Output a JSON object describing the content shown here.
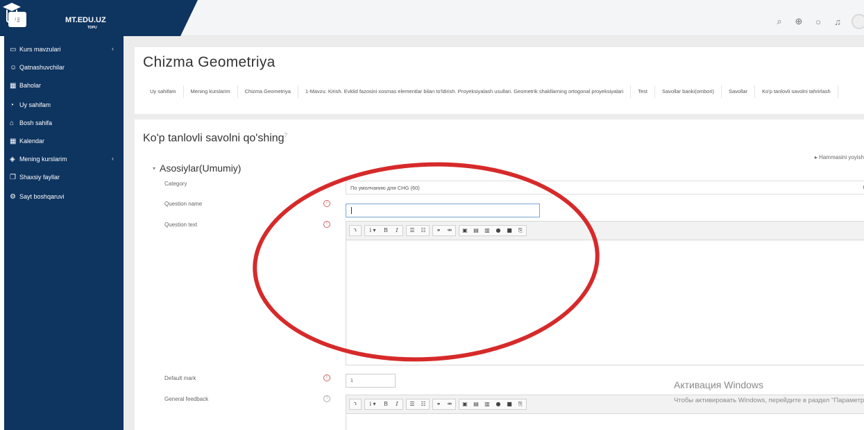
{
  "brand": {
    "name": "MT.EDU.UZ",
    "sub": "TDPU"
  },
  "sidebar": {
    "items": [
      {
        "label": "Kurs mavzulari",
        "icon": "folder-icon",
        "glyph": "▭",
        "chevron": "‹"
      },
      {
        "label": "Qatnashuvchilar",
        "icon": "users-icon",
        "glyph": "☺"
      },
      {
        "label": "Baholar",
        "icon": "grades-icon",
        "glyph": "▦"
      },
      {
        "label": "Uy sahifam",
        "icon": "dashboard-icon",
        "glyph": "◔"
      },
      {
        "label": "Bosh sahifa",
        "icon": "home-icon",
        "glyph": "⌂"
      },
      {
        "label": "Kalendar",
        "icon": "calendar-icon",
        "glyph": "▦"
      },
      {
        "label": "Mening kurslarim",
        "icon": "graduation-cap-icon",
        "glyph": "◈",
        "chevron": "‹"
      },
      {
        "label": "Shaxsiy fayllar",
        "icon": "files-icon",
        "glyph": "❐"
      },
      {
        "label": "Sayt boshqaruvi",
        "icon": "gear-icon",
        "glyph": "⚙"
      }
    ]
  },
  "header": {
    "title": "Chizma Geometriya",
    "breadcrumbs": [
      "Uy sahifam",
      "Mening kurslarim",
      "Chizma Geometriya",
      "1-Mavzu: Kirish. Evklid fazosini xosmas elementlar bilan to'ldirish. Proyeksiyalash usullari. Geometrik shakllarning ortogonal proyeksiyalari",
      "Test",
      "Savollar banki(ombori)",
      "Savollar",
      "Ko'p tanlovli savolni tahrirlash"
    ]
  },
  "form": {
    "heading": "Ko'p tanlovli savolni qo'shing",
    "heading_help": "?",
    "expand_all": "▸ Hammasini yoyish",
    "legend": "Asosiylar(Umumiy)",
    "legend_toggle": "▾",
    "category_label": "Category",
    "category_value": "По умолчанию для CHG (60)",
    "question_name_label": "Question name",
    "question_name_value": "",
    "question_text_label": "Question text",
    "default_mark_label": "Default mark",
    "default_mark_value": "1",
    "general_feedback_label": "General feedback",
    "help_glyph": "!"
  },
  "toolbar_buttons": [
    [
      "⤵"
    ],
    [
      "i ▾",
      "B",
      "I"
    ],
    [
      "☰",
      "☷"
    ],
    [
      "⚭",
      "⚮"
    ],
    [
      "▣",
      "▤",
      "▥",
      "●",
      "■",
      "⎘"
    ]
  ],
  "watermark": {
    "title": "Активация Windows",
    "text": "Чтобы активировать Windows, перейдите в раздел \"Параметры\"."
  },
  "colors": {
    "sidebar": "#0e3460",
    "annotation": "#d62a2a"
  }
}
